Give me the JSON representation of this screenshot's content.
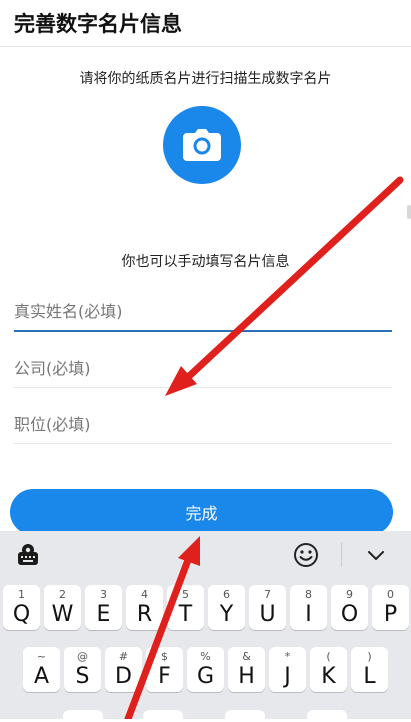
{
  "header": {
    "title": "完善数字名片信息"
  },
  "scan": {
    "hint": "请将你的纸质名片进行扫描生成数字名片",
    "camera_icon": "camera-icon"
  },
  "manual": {
    "hint": "你也可以手动填写名片信息"
  },
  "form": {
    "name_placeholder": "真实姓名(必填)",
    "company_placeholder": "公司(必填)",
    "position_placeholder": "职位(必填)",
    "name_value": "",
    "company_value": "",
    "position_value": ""
  },
  "done_label": "完成",
  "colors": {
    "accent": "#1a87ea",
    "arrow": "#e0201c",
    "keyboard_bg": "#e7e8ec"
  },
  "keyboard": {
    "toolbar_icons": [
      "keyboard-settings-icon",
      "emoji-icon",
      "collapse-keyboard-icon"
    ],
    "row1": [
      {
        "key": "Q",
        "sub": "1"
      },
      {
        "key": "W",
        "sub": "2"
      },
      {
        "key": "E",
        "sub": "3"
      },
      {
        "key": "R",
        "sub": "4"
      },
      {
        "key": "T",
        "sub": "5"
      },
      {
        "key": "Y",
        "sub": "6"
      },
      {
        "key": "U",
        "sub": "7"
      },
      {
        "key": "I",
        "sub": "8"
      },
      {
        "key": "O",
        "sub": "9"
      },
      {
        "key": "P",
        "sub": "0"
      }
    ],
    "row2": [
      {
        "key": "A",
        "sub": "~"
      },
      {
        "key": "S",
        "sub": "@"
      },
      {
        "key": "D",
        "sub": "#"
      },
      {
        "key": "F",
        "sub": "$"
      },
      {
        "key": "G",
        "sub": "%"
      },
      {
        "key": "H",
        "sub": "&"
      },
      {
        "key": "J",
        "sub": "*"
      },
      {
        "key": "K",
        "sub": "("
      },
      {
        "key": "L",
        "sub": ")"
      }
    ]
  }
}
